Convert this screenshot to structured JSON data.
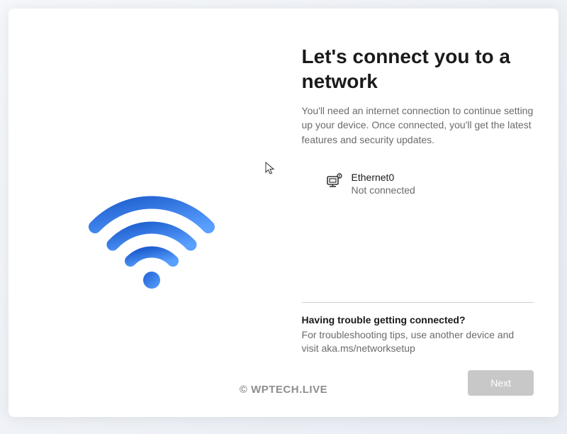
{
  "header": {
    "title": "Let's connect you to a network",
    "subtitle": "You'll need an internet connection to continue setting up your device. Once connected, you'll get the latest features and security updates."
  },
  "networks": [
    {
      "name": "Ethernet0",
      "status": "Not connected"
    }
  ],
  "trouble": {
    "heading": "Having trouble getting connected?",
    "text": "For troubleshooting tips, use another device and visit aka.ms/networksetup"
  },
  "actions": {
    "next_label": "Next"
  },
  "watermark": "©  WPTECH.LIVE",
  "colors": {
    "wifi_gradient_start": "#2b6de0",
    "wifi_gradient_end": "#4a8cff"
  }
}
